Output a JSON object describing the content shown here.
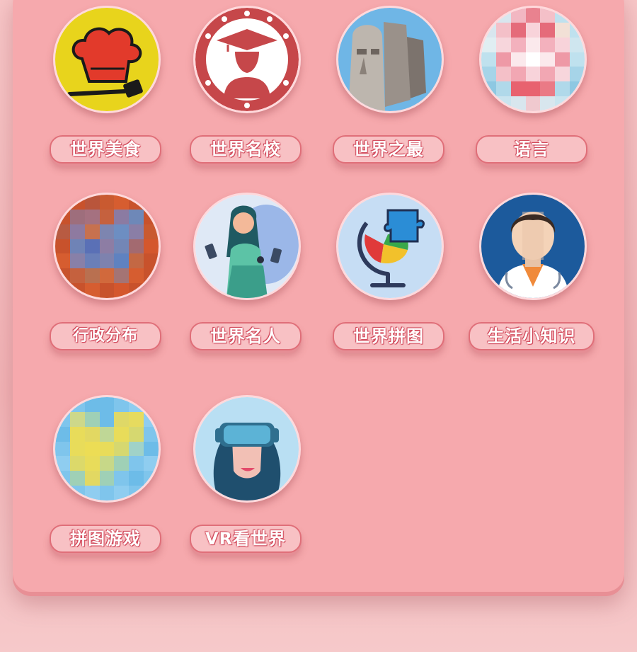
{
  "items": [
    {
      "label": "世界美食",
      "icon": "chef-hat-icon"
    },
    {
      "label": "世界名校",
      "icon": "graduate-icon"
    },
    {
      "label": "世界之最",
      "icon": "moai-statue-icon"
    },
    {
      "label": "语言",
      "icon": "language-icon"
    },
    {
      "label": "行政分布",
      "icon": "map-icon"
    },
    {
      "label": "世界名人",
      "icon": "famous-person-icon"
    },
    {
      "label": "世界拼图",
      "icon": "globe-puzzle-icon"
    },
    {
      "label": "生活小知识",
      "icon": "doctor-icon"
    },
    {
      "label": "拼图游戏",
      "icon": "puzzle-game-icon"
    },
    {
      "label": "VR看世界",
      "icon": "vr-headset-icon"
    }
  ],
  "colors": {
    "background": "#f6a9ad",
    "label_fill": "#f8c1c4",
    "label_border": "#e06f79"
  }
}
